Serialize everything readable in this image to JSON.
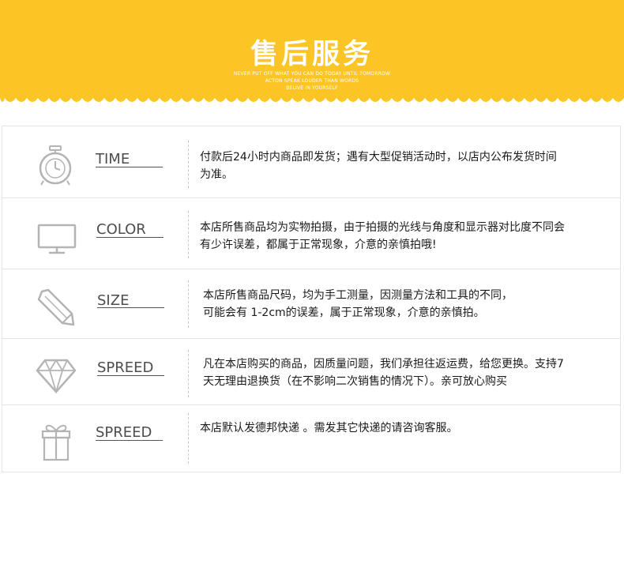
{
  "colors": {
    "banner": "#FCC526",
    "icon": "#b4b4b4",
    "text": "#1a1a1a",
    "label": "#4d4d4d"
  },
  "banner": {
    "title": "售后服务",
    "taglines": [
      "NEVER PUT OFF WHAT YOU CAN DO TODAY UNTIL TOMORROW",
      "ACTON SPEAK LOUDER THAN WORDS",
      "BELIVE IN YOURSELF"
    ]
  },
  "rows": [
    {
      "icon": "stopwatch-icon",
      "label": "TIME",
      "desc": [
        "付款后24小时内商品即发货；遇有大型促销活动时，以店内公布发货时间",
        "为准。"
      ]
    },
    {
      "icon": "monitor-icon",
      "label": "COLOR",
      "desc": [
        "本店所售商品均为实物拍摄，由于拍摄的光线与角度和显示器对比度不同会",
        "有少许误差，都属于正常现象，介意的亲慎拍哦!"
      ]
    },
    {
      "icon": "pencil-icon",
      "label": "SIZE",
      "desc": [
        "本店所售商品尺码，均为手工测量，因测量方法和工具的不同，",
        "可能会有 1-2cm的误差，属于正常现象，介意的亲慎拍。"
      ]
    },
    {
      "icon": "diamond-icon",
      "label": "SPREED",
      "desc": [
        "凡在本店购买的商品，因质量问题，我们承担往返运费，给您更换。支持7",
        "天无理由退换货（在不影响二次销售的情况下）。亲可放心购买"
      ]
    },
    {
      "icon": "gift-icon",
      "label": "SPREED",
      "desc": [
        "本店默认发德邦快递 。需发其它快递的请咨询客服。"
      ]
    }
  ]
}
